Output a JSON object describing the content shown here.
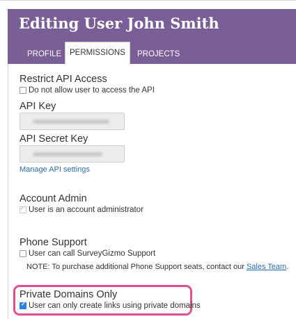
{
  "header": {
    "title": "Editing User John Smith",
    "tabs": [
      {
        "label": "PROFILE",
        "active": false
      },
      {
        "label": "PERMISSIONS",
        "active": true
      },
      {
        "label": "PROJECTS",
        "active": false
      }
    ]
  },
  "restrict_api": {
    "heading": "Restrict API Access",
    "checkbox_label": "Do not allow user to access the API",
    "checked": false
  },
  "api_key": {
    "label": "API Key"
  },
  "api_secret": {
    "label": "API Secret Key",
    "manage_link": "Manage API settings"
  },
  "account_admin": {
    "heading": "Account Admin",
    "checkbox_label": "User is an account administrator",
    "checked": true
  },
  "phone_support": {
    "heading": "Phone Support",
    "checkbox_label": "User can call SurveyGizmo Support",
    "checked": false,
    "note": "NOTE: To purchase additional Phone Support seats, contact our",
    "note_link": "Sales Team",
    "note_end": "."
  },
  "private_domains": {
    "heading": "Private Domains Only",
    "checkbox_label": "User can only create links using private domains",
    "checked": true
  },
  "colors": {
    "header_bg": "#7a5f97",
    "highlight": "#e0508b",
    "link": "#2b6cb0",
    "checkbox_checked": "#2f7fe0"
  }
}
